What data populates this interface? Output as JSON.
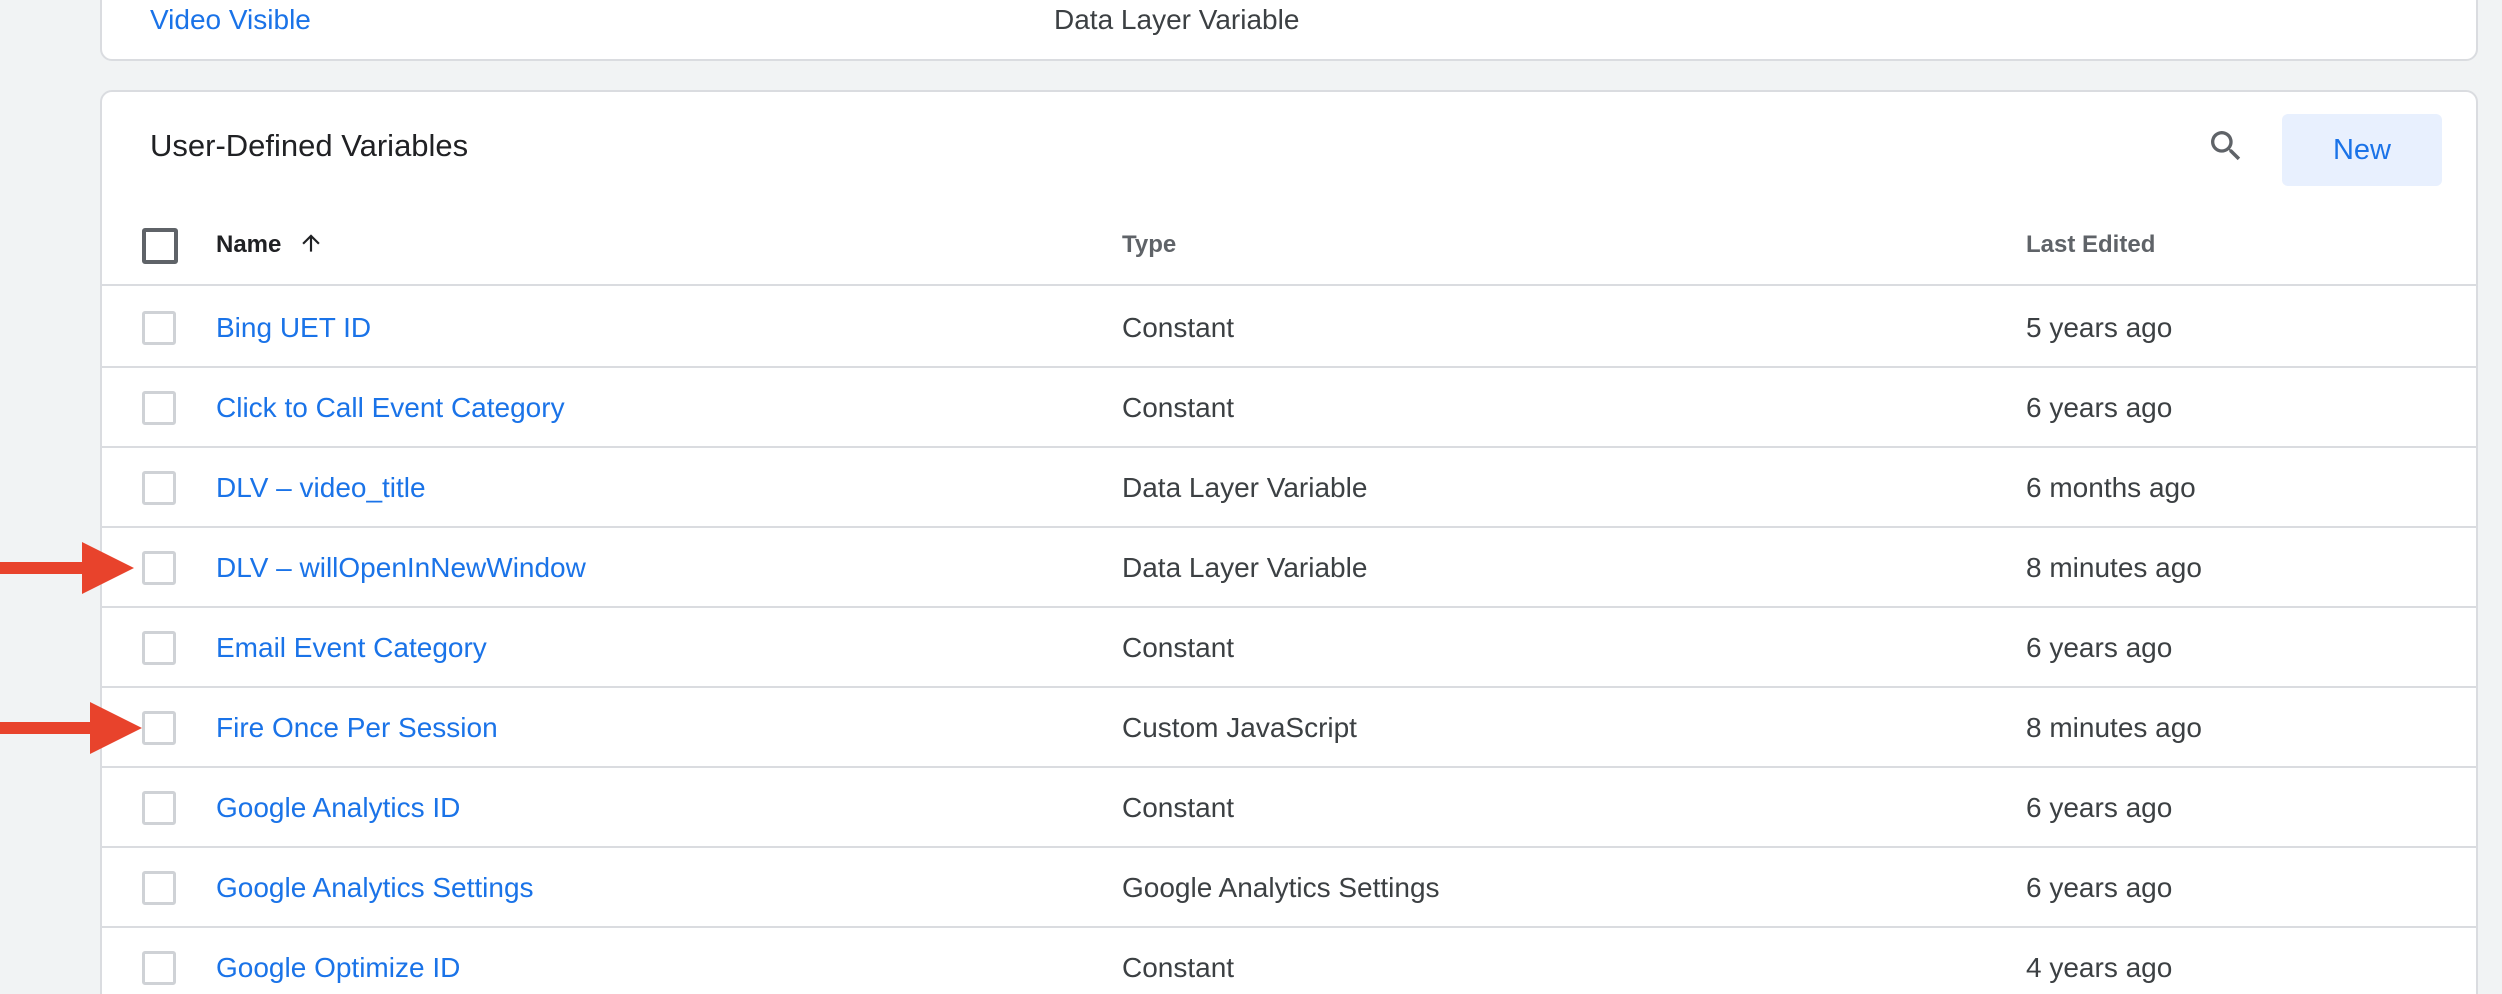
{
  "builtin": {
    "last_row": {
      "name": "Video Visible",
      "type": "Data Layer Variable"
    }
  },
  "user_defined": {
    "title": "User-Defined Variables",
    "search_icon": "search-icon",
    "new_label": "New",
    "headers": {
      "name": "Name",
      "type": "Type",
      "last_edited": "Last Edited"
    },
    "sort": {
      "column": "name",
      "direction": "ascending",
      "icon": "arrow-up-icon"
    },
    "rows": [
      {
        "name": "Bing UET ID",
        "type": "Constant",
        "last_edited": "5 years ago"
      },
      {
        "name": "Click to Call Event Category",
        "type": "Constant",
        "last_edited": "6 years ago"
      },
      {
        "name": "DLV – video_title",
        "type": "Data Layer Variable",
        "last_edited": "6 months ago"
      },
      {
        "name": "DLV – willOpenInNewWindow",
        "type": "Data Layer Variable",
        "last_edited": "8 minutes ago"
      },
      {
        "name": "Email Event Category",
        "type": "Constant",
        "last_edited": "6 years ago"
      },
      {
        "name": "Fire Once Per Session",
        "type": "Custom JavaScript",
        "last_edited": "8 minutes ago"
      },
      {
        "name": "Google Analytics ID",
        "type": "Constant",
        "last_edited": "6 years ago"
      },
      {
        "name": "Google Analytics Settings",
        "type": "Google Analytics Settings",
        "last_edited": "6 years ago"
      },
      {
        "name": "Google Optimize ID",
        "type": "Constant",
        "last_edited": "4 years ago"
      }
    ]
  },
  "annotations": {
    "arrow_color": "#e8432c",
    "icon": "red-arrow-icon"
  },
  "colors": {
    "link": "#1a73e8",
    "new_button_bg": "#e8f0fe",
    "border": "#dadce0",
    "page_bg": "#f1f3f4"
  }
}
